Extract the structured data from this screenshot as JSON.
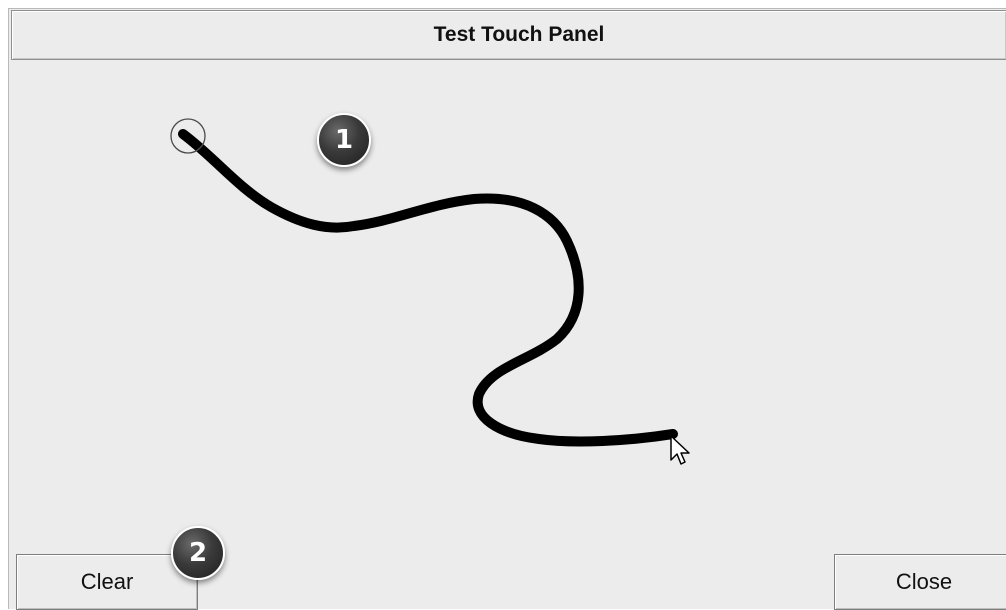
{
  "window": {
    "title": "Test Touch Panel"
  },
  "buttons": {
    "clear_label": "Clear",
    "close_label": "Close"
  },
  "callouts": {
    "one": "1",
    "two": "2"
  },
  "icons": {
    "start_marker": "touch-start-circle",
    "cursor": "mouse-pointer-arrow"
  },
  "colors": {
    "background": "#ececec",
    "stroke": "#000000",
    "badge": "#2e2e2e"
  }
}
